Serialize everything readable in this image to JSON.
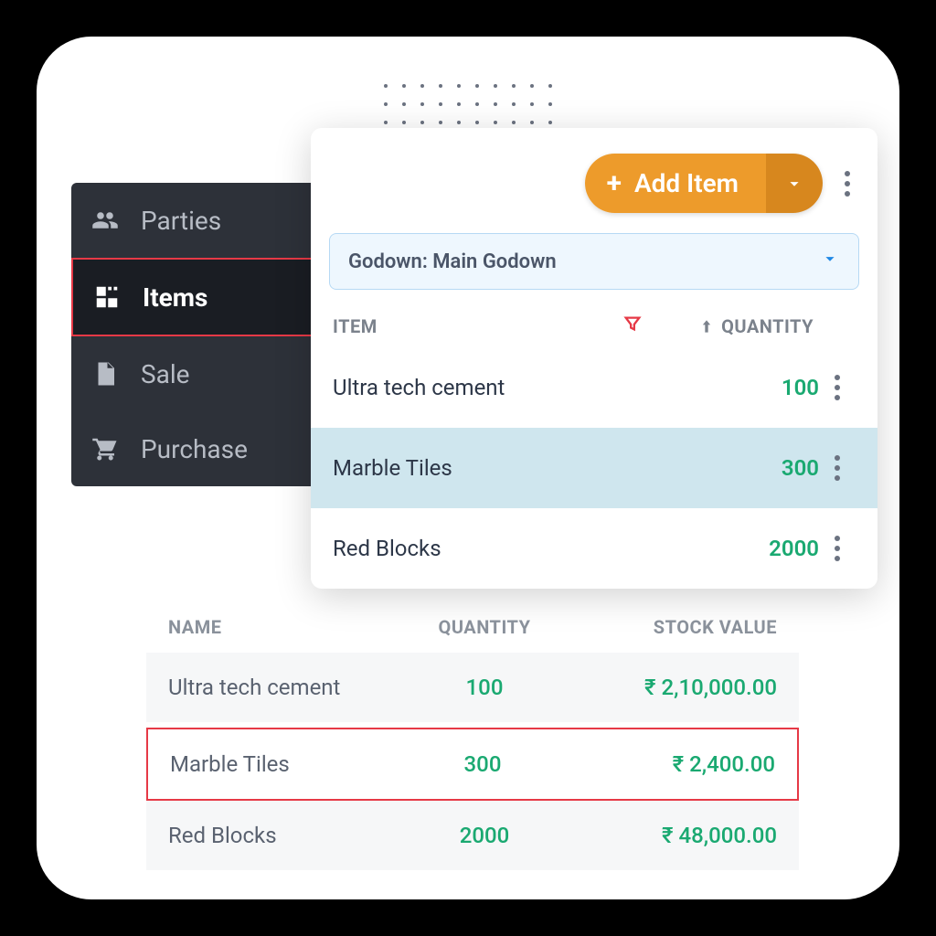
{
  "sidebar": {
    "items": [
      {
        "label": "Parties"
      },
      {
        "label": "Items"
      },
      {
        "label": "Sale"
      },
      {
        "label": "Purchase"
      }
    ],
    "active_index": 1
  },
  "panel": {
    "add_button_label": "Add Item",
    "godown_label": "Godown: Main Godown",
    "columns": {
      "item": "ITEM",
      "quantity": "QUANTITY"
    },
    "rows": [
      {
        "name": "Ultra tech cement",
        "qty": "100"
      },
      {
        "name": "Marble Tiles",
        "qty": "300"
      },
      {
        "name": "Red Blocks",
        "qty": "2000"
      }
    ],
    "selected_index": 1
  },
  "stock": {
    "columns": {
      "name": "NAME",
      "quantity": "QUANTITY",
      "stock_value": "STOCK VALUE"
    },
    "rows": [
      {
        "name": "Ultra tech cement",
        "qty": "100",
        "value": "₹ 2,10,000.00"
      },
      {
        "name": "Marble Tiles",
        "qty": "300",
        "value": "₹ 2,400.00"
      },
      {
        "name": "Red Blocks",
        "qty": "2000",
        "value": "₹ 48,000.00"
      }
    ],
    "highlight_index": 1
  },
  "colors": {
    "accent_orange": "#ed9b2b",
    "accent_orange_dark": "#d7871e",
    "green": "#1aa971",
    "red_outline": "#e63946",
    "blue_soft": "#eef7fe"
  }
}
